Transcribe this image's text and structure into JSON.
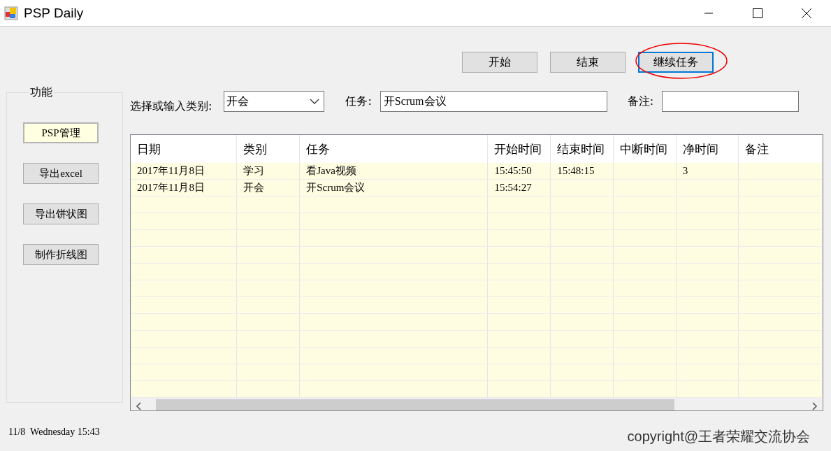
{
  "window": {
    "title": "PSP Daily"
  },
  "action_buttons": [
    {
      "label": "开始",
      "focused": false,
      "annotated": false
    },
    {
      "label": "结束",
      "focused": false,
      "annotated": false
    },
    {
      "label": "继续任务",
      "focused": true,
      "annotated": true
    }
  ],
  "side_panel": {
    "title": "功能",
    "items": [
      {
        "label": "PSP管理",
        "selected": true
      },
      {
        "label": "导出excel",
        "selected": false
      },
      {
        "label": "导出饼状图",
        "selected": false
      },
      {
        "label": "制作折线图",
        "selected": false
      }
    ]
  },
  "form": {
    "category_label": "选择或输入类别:",
    "category_value": "开会",
    "task_label": "任务:",
    "task_value": "开Scrum会议",
    "note_label": "备注:"
  },
  "table": {
    "columns": [
      "日期",
      "类别",
      "任务",
      "开始时间",
      "结束时间",
      "中断时间",
      "净时间",
      "备注"
    ],
    "rows": [
      [
        "2017年11月8日",
        "学习",
        "看Java视频",
        "15:45:50",
        "15:48:15",
        "",
        "3",
        ""
      ],
      [
        "2017年11月8日",
        "开会",
        "开Scrum会议",
        "15:54:27",
        "",
        "",
        "",
        ""
      ]
    ]
  },
  "status_bar": {
    "datetime": "11/8  Wednesday 15:43",
    "copyright": "copyright@王者荣耀交流协会"
  }
}
